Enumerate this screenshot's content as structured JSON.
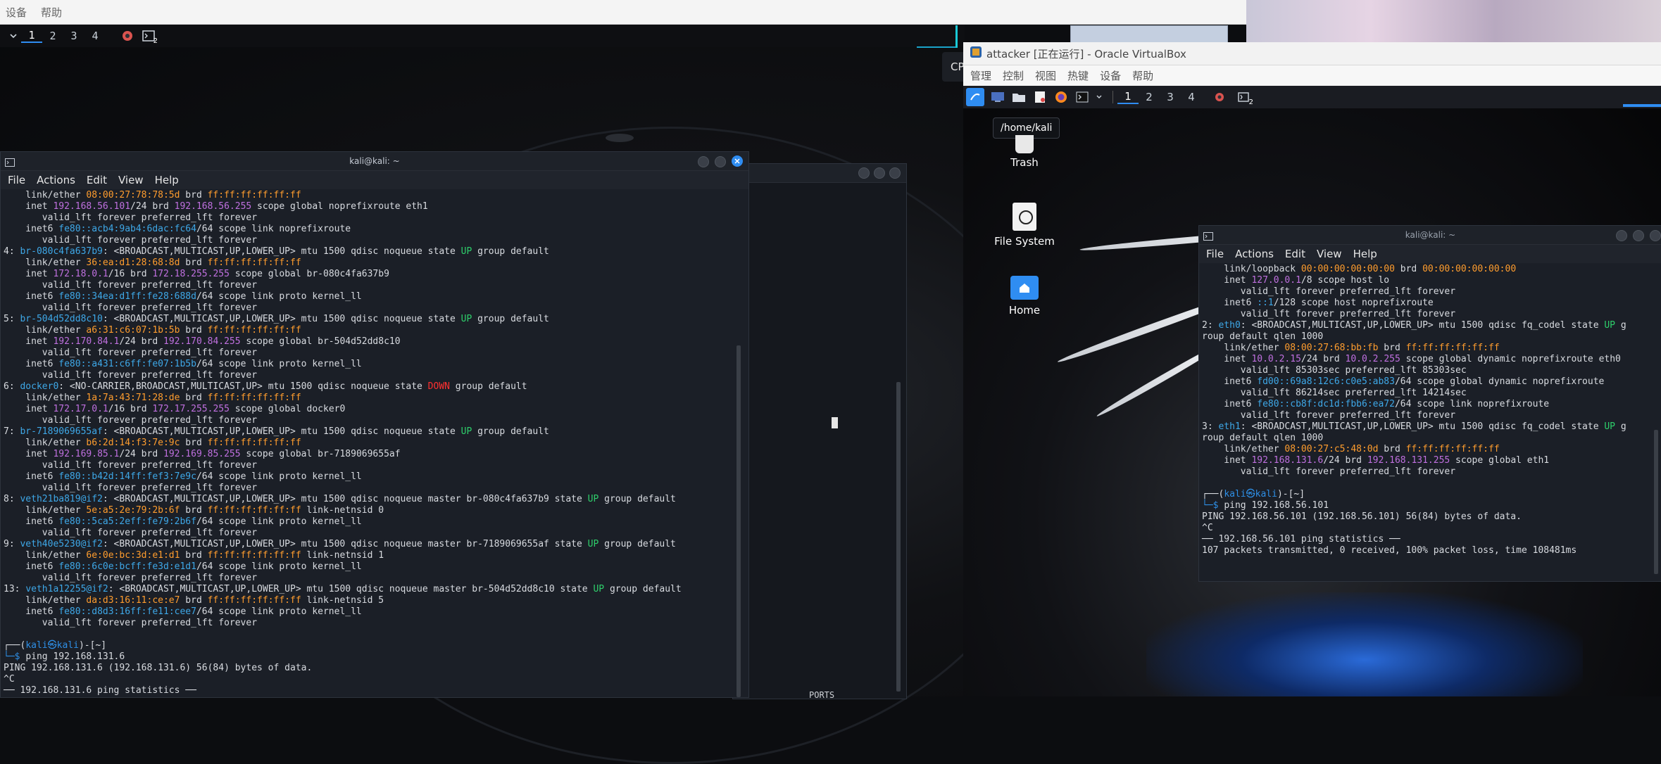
{
  "host": {
    "menubar": [
      "设备",
      "帮助"
    ],
    "workspaces": [
      "1",
      "2",
      "3",
      "4"
    ],
    "active_workspace": "1",
    "panel_badge": "2",
    "overlap_text": "CP"
  },
  "left_terminal": {
    "title": "kali@kali: ~",
    "menu": [
      "File",
      "Actions",
      "Edit",
      "View",
      "Help"
    ],
    "lines": [
      [
        [
          "    link/ether ",
          ""
        ],
        [
          "08:00:27:78:78:5d",
          "or"
        ],
        [
          " brd ",
          ""
        ],
        [
          "ff:ff:ff:ff:ff:ff",
          "or"
        ]
      ],
      [
        [
          "    inet ",
          ""
        ],
        [
          "192.168.56.101",
          "pu"
        ],
        [
          "/24 brd ",
          ""
        ],
        [
          "192.168.56.255",
          "pu"
        ],
        [
          " scope global noprefixroute eth1",
          ""
        ]
      ],
      [
        [
          "       valid_lft forever preferred_lft forever",
          ""
        ]
      ],
      [
        [
          "    inet6 ",
          ""
        ],
        [
          "fe80::acb4:9ab4:6dac:fc64",
          "cy"
        ],
        [
          "/64 scope link noprefixroute",
          ""
        ]
      ],
      [
        [
          "       valid_lft forever preferred_lft forever",
          ""
        ]
      ],
      [
        [
          "4: ",
          ""
        ],
        [
          "br-080c4fa637b9",
          "cy"
        ],
        [
          ": <BROADCAST,MULTICAST,UP,LOWER_UP> mtu 1500 qdisc noqueue state ",
          ""
        ],
        [
          "UP",
          "gr"
        ],
        [
          " group default",
          ""
        ]
      ],
      [
        [
          "    link/ether ",
          ""
        ],
        [
          "36:ea:d1:28:68:8d",
          "or"
        ],
        [
          " brd ",
          ""
        ],
        [
          "ff:ff:ff:ff:ff:ff",
          "or"
        ]
      ],
      [
        [
          "    inet ",
          ""
        ],
        [
          "172.18.0.1",
          "pu"
        ],
        [
          "/16 brd ",
          ""
        ],
        [
          "172.18.255.255",
          "pu"
        ],
        [
          " scope global br-080c4fa637b9",
          ""
        ]
      ],
      [
        [
          "       valid_lft forever preferred_lft forever",
          ""
        ]
      ],
      [
        [
          "    inet6 ",
          ""
        ],
        [
          "fe80::34ea:d1ff:fe28:688d",
          "cy"
        ],
        [
          "/64 scope link proto kernel_ll",
          ""
        ]
      ],
      [
        [
          "       valid_lft forever preferred_lft forever",
          ""
        ]
      ],
      [
        [
          "5: ",
          ""
        ],
        [
          "br-504d52dd8c10",
          "cy"
        ],
        [
          ": <BROADCAST,MULTICAST,UP,LOWER_UP> mtu 1500 qdisc noqueue state ",
          ""
        ],
        [
          "UP",
          "gr"
        ],
        [
          " group default",
          ""
        ]
      ],
      [
        [
          "    link/ether ",
          ""
        ],
        [
          "a6:31:c6:07:1b:5b",
          "or"
        ],
        [
          " brd ",
          ""
        ],
        [
          "ff:ff:ff:ff:ff:ff",
          "or"
        ]
      ],
      [
        [
          "    inet ",
          ""
        ],
        [
          "192.170.84.1",
          "pu"
        ],
        [
          "/24 brd ",
          ""
        ],
        [
          "192.170.84.255",
          "pu"
        ],
        [
          " scope global br-504d52dd8c10",
          ""
        ]
      ],
      [
        [
          "       valid_lft forever preferred_lft forever",
          ""
        ]
      ],
      [
        [
          "    inet6 ",
          ""
        ],
        [
          "fe80::a431:c6ff:fe07:1b5b",
          "cy"
        ],
        [
          "/64 scope link proto kernel_ll",
          ""
        ]
      ],
      [
        [
          "       valid_lft forever preferred_lft forever",
          ""
        ]
      ],
      [
        [
          "6: ",
          ""
        ],
        [
          "docker0",
          "cy"
        ],
        [
          ": <NO-CARRIER,BROADCAST,MULTICAST,UP> mtu 1500 qdisc noqueue state ",
          ""
        ],
        [
          "DOWN",
          "re"
        ],
        [
          " group default",
          ""
        ]
      ],
      [
        [
          "    link/ether ",
          ""
        ],
        [
          "1a:7a:43:71:28:de",
          "or"
        ],
        [
          " brd ",
          ""
        ],
        [
          "ff:ff:ff:ff:ff:ff",
          "or"
        ]
      ],
      [
        [
          "    inet ",
          ""
        ],
        [
          "172.17.0.1",
          "pu"
        ],
        [
          "/16 brd ",
          ""
        ],
        [
          "172.17.255.255",
          "pu"
        ],
        [
          " scope global docker0",
          ""
        ]
      ],
      [
        [
          "       valid_lft forever preferred_lft forever",
          ""
        ]
      ],
      [
        [
          "7: ",
          ""
        ],
        [
          "br-7189069655af",
          "cy"
        ],
        [
          ": <BROADCAST,MULTICAST,UP,LOWER_UP> mtu 1500 qdisc noqueue state ",
          ""
        ],
        [
          "UP",
          "gr"
        ],
        [
          " group default",
          ""
        ]
      ],
      [
        [
          "    link/ether ",
          ""
        ],
        [
          "b6:2d:14:f3:7e:9c",
          "or"
        ],
        [
          " brd ",
          ""
        ],
        [
          "ff:ff:ff:ff:ff:ff",
          "or"
        ]
      ],
      [
        [
          "    inet ",
          ""
        ],
        [
          "192.169.85.1",
          "pu"
        ],
        [
          "/24 brd ",
          ""
        ],
        [
          "192.169.85.255",
          "pu"
        ],
        [
          " scope global br-7189069655af",
          ""
        ]
      ],
      [
        [
          "       valid_lft forever preferred_lft forever",
          ""
        ]
      ],
      [
        [
          "    inet6 ",
          ""
        ],
        [
          "fe80::b42d:14ff:fef3:7e9c",
          "cy"
        ],
        [
          "/64 scope link proto kernel_ll",
          ""
        ]
      ],
      [
        [
          "       valid_lft forever preferred_lft forever",
          ""
        ]
      ],
      [
        [
          "8: ",
          ""
        ],
        [
          "veth21ba819@if2",
          "cy"
        ],
        [
          ": <BROADCAST,MULTICAST,UP,LOWER_UP> mtu 1500 qdisc noqueue master br-080c4fa637b9 state ",
          ""
        ],
        [
          "UP",
          "gr"
        ],
        [
          " group default",
          ""
        ]
      ],
      [
        [
          "    link/ether ",
          ""
        ],
        [
          "5e:a5:2e:79:2b:6f",
          "or"
        ],
        [
          " brd ",
          ""
        ],
        [
          "ff:ff:ff:ff:ff:ff",
          "or"
        ],
        [
          " link-netnsid 0",
          ""
        ]
      ],
      [
        [
          "    inet6 ",
          ""
        ],
        [
          "fe80::5ca5:2eff:fe79:2b6f",
          "cy"
        ],
        [
          "/64 scope link proto kernel_ll",
          ""
        ]
      ],
      [
        [
          "       valid_lft forever preferred_lft forever",
          ""
        ]
      ],
      [
        [
          "9: ",
          ""
        ],
        [
          "veth40e5230@if2",
          "cy"
        ],
        [
          ": <BROADCAST,MULTICAST,UP,LOWER_UP> mtu 1500 qdisc noqueue master br-7189069655af state ",
          ""
        ],
        [
          "UP",
          "gr"
        ],
        [
          " group default",
          ""
        ]
      ],
      [
        [
          "    link/ether ",
          ""
        ],
        [
          "6e:0e:bc:3d:e1:d1",
          "or"
        ],
        [
          " brd ",
          ""
        ],
        [
          "ff:ff:ff:ff:ff:ff",
          "or"
        ],
        [
          " link-netnsid 1",
          ""
        ]
      ],
      [
        [
          "    inet6 ",
          ""
        ],
        [
          "fe80::6c0e:bcff:fe3d:e1d1",
          "cy"
        ],
        [
          "/64 scope link proto kernel_ll",
          ""
        ]
      ],
      [
        [
          "       valid_lft forever preferred_lft forever",
          ""
        ]
      ],
      [
        [
          "13: ",
          ""
        ],
        [
          "veth1a12255@if2",
          "cy"
        ],
        [
          ": <BROADCAST,MULTICAST,UP,LOWER_UP> mtu 1500 qdisc noqueue master br-504d52dd8c10 state ",
          ""
        ],
        [
          "UP",
          "gr"
        ],
        [
          " group default",
          ""
        ]
      ],
      [
        [
          "    link/ether ",
          ""
        ],
        [
          "da:d3:16:11:ce:e7",
          "or"
        ],
        [
          " brd ",
          ""
        ],
        [
          "ff:ff:ff:ff:ff:ff",
          "or"
        ],
        [
          " link-netnsid 5",
          ""
        ]
      ],
      [
        [
          "    inet6 ",
          ""
        ],
        [
          "fe80::d8d3:16ff:fe11:cee7",
          "cy"
        ],
        [
          "/64 scope link proto kernel_ll",
          ""
        ]
      ],
      [
        [
          "       valid_lft forever preferred_lft forever",
          ""
        ]
      ],
      [
        [
          "",
          ""
        ]
      ],
      [
        [
          "┌──(",
          ""
        ],
        [
          "kali㉿kali",
          "prm"
        ],
        [
          ")-[",
          ""
        ],
        [
          "~",
          "wh"
        ],
        [
          "]",
          ""
        ]
      ],
      [
        [
          "└─$ ",
          "prm"
        ],
        [
          "ping 192.168.131.6",
          ""
        ]
      ],
      [
        [
          "PING 192.168.131.6 (192.168.131.6) 56(84) bytes of data.",
          ""
        ]
      ],
      [
        [
          "^C",
          ""
        ]
      ],
      [
        [
          "── 192.168.131.6 ping statistics ──",
          ""
        ]
      ]
    ]
  },
  "bg_window": {
    "label": "PORTS"
  },
  "virtualbox": {
    "title": "attacker [正在运行] - Oracle VirtualBox",
    "menu": [
      "管理",
      "控制",
      "视图",
      "热键",
      "设备",
      "帮助"
    ],
    "guest_workspaces": [
      "1",
      "2",
      "3",
      "4"
    ],
    "guest_badge": "2",
    "tooltip": "/home/kali",
    "desktop_icons": [
      "Trash",
      "File System",
      "Home"
    ]
  },
  "right_terminal": {
    "title": "kali@kali: ~",
    "menu": [
      "File",
      "Actions",
      "Edit",
      "View",
      "Help"
    ],
    "lines": [
      [
        [
          "    link/loopback ",
          ""
        ],
        [
          "00:00:00:00:00:00",
          "or"
        ],
        [
          " brd ",
          ""
        ],
        [
          "00:00:00:00:00:00",
          "or"
        ]
      ],
      [
        [
          "    inet ",
          ""
        ],
        [
          "127.0.0.1",
          "pu"
        ],
        [
          "/8 scope host lo",
          ""
        ]
      ],
      [
        [
          "       valid_lft forever preferred_lft forever",
          ""
        ]
      ],
      [
        [
          "    inet6 ",
          ""
        ],
        [
          "::1",
          "cy"
        ],
        [
          "/128 scope host noprefixroute",
          ""
        ]
      ],
      [
        [
          "       valid_lft forever preferred_lft forever",
          ""
        ]
      ],
      [
        [
          "2: ",
          ""
        ],
        [
          "eth0",
          "cy"
        ],
        [
          ": <BROADCAST,MULTICAST,UP,LOWER_UP> mtu 1500 qdisc fq_codel state ",
          ""
        ],
        [
          "UP",
          "gr"
        ],
        [
          " g",
          ""
        ]
      ],
      [
        [
          "roup default qlen 1000",
          ""
        ]
      ],
      [
        [
          "    link/ether ",
          ""
        ],
        [
          "08:00:27:68:bb:fb",
          "or"
        ],
        [
          " brd ",
          ""
        ],
        [
          "ff:ff:ff:ff:ff:ff",
          "or"
        ]
      ],
      [
        [
          "    inet ",
          ""
        ],
        [
          "10.0.2.15",
          "pu"
        ],
        [
          "/24 brd ",
          ""
        ],
        [
          "10.0.2.255",
          "pu"
        ],
        [
          " scope global dynamic noprefixroute eth0",
          ""
        ]
      ],
      [
        [
          "       valid_lft 85303sec preferred_lft 85303sec",
          ""
        ]
      ],
      [
        [
          "    inet6 ",
          ""
        ],
        [
          "fd00::69a8:12c6:c0e5:ab83",
          "cy"
        ],
        [
          "/64 scope global dynamic noprefixroute",
          ""
        ]
      ],
      [
        [
          "       valid_lft 86214sec preferred_lft 14214sec",
          ""
        ]
      ],
      [
        [
          "    inet6 ",
          ""
        ],
        [
          "fe80::cb8f:dc1d:fbb6:ea72",
          "cy"
        ],
        [
          "/64 scope link noprefixroute",
          ""
        ]
      ],
      [
        [
          "       valid_lft forever preferred_lft forever",
          ""
        ]
      ],
      [
        [
          "3: ",
          ""
        ],
        [
          "eth1",
          "cy"
        ],
        [
          ": <BROADCAST,MULTICAST,UP,LOWER_UP> mtu 1500 qdisc fq_codel state ",
          ""
        ],
        [
          "UP",
          "gr"
        ],
        [
          " g",
          ""
        ]
      ],
      [
        [
          "roup default qlen 1000",
          ""
        ]
      ],
      [
        [
          "    link/ether ",
          ""
        ],
        [
          "08:00:27:c5:48:0d",
          "or"
        ],
        [
          " brd ",
          ""
        ],
        [
          "ff:ff:ff:ff:ff:ff",
          "or"
        ]
      ],
      [
        [
          "    inet ",
          ""
        ],
        [
          "192.168.131.6",
          "pu"
        ],
        [
          "/24 brd ",
          ""
        ],
        [
          "192.168.131.255",
          "pu"
        ],
        [
          " scope global eth1",
          ""
        ]
      ],
      [
        [
          "       valid_lft forever preferred_lft forever",
          ""
        ]
      ],
      [
        [
          "",
          ""
        ]
      ],
      [
        [
          "┌──(",
          ""
        ],
        [
          "kali㉿kali",
          "prm"
        ],
        [
          ")-[",
          ""
        ],
        [
          "~",
          "wh"
        ],
        [
          "]",
          ""
        ]
      ],
      [
        [
          "└─$ ",
          "prm"
        ],
        [
          "ping 192.168.56.101",
          ""
        ]
      ],
      [
        [
          "PING 192.168.56.101 (192.168.56.101) 56(84) bytes of data.",
          ""
        ]
      ],
      [
        [
          "^C",
          ""
        ]
      ],
      [
        [
          "── 192.168.56.101 ping statistics ──",
          ""
        ]
      ],
      [
        [
          "107 packets transmitted, 0 received, 100% packet loss, time 108481ms",
          ""
        ]
      ]
    ]
  }
}
